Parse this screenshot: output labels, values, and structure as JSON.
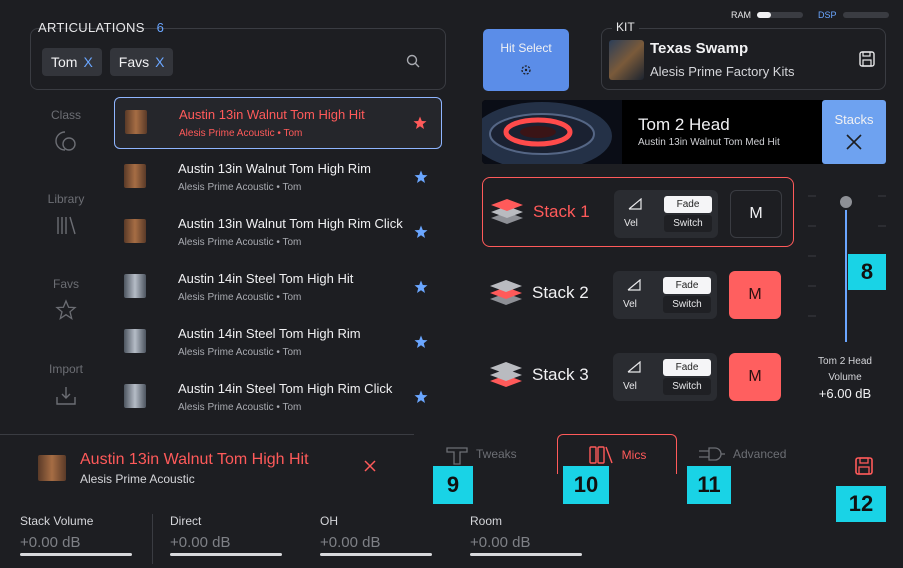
{
  "articulations": {
    "title": "ARTICULATIONS",
    "count": "6",
    "chips": [
      "Tom",
      "Favs"
    ]
  },
  "sidebar": {
    "items": [
      {
        "label": "Class",
        "icon": "class-icon"
      },
      {
        "label": "Library",
        "icon": "library-icon"
      },
      {
        "label": "Favs",
        "icon": "star-outline-icon"
      },
      {
        "label": "Import",
        "icon": "import-icon"
      }
    ]
  },
  "list": [
    {
      "name": "Austin 13in Walnut Tom High Hit",
      "sub": "Alesis Prime Acoustic • Tom",
      "selected": true,
      "star_color": "#ff5a5a"
    },
    {
      "name": "Austin 13in Walnut Tom High Rim",
      "sub": "Alesis Prime Acoustic • Tom",
      "selected": false
    },
    {
      "name": "Austin 13in Walnut Tom High Rim Click",
      "sub": "Alesis Prime Acoustic • Tom",
      "selected": false
    },
    {
      "name": "Austin 14in Steel Tom High Hit",
      "sub": "Alesis Prime Acoustic • Tom",
      "selected": false
    },
    {
      "name": "Austin 14in Steel Tom High Rim",
      "sub": "Alesis Prime Acoustic • Tom",
      "selected": false
    },
    {
      "name": "Austin 14in Steel Tom High Rim Click",
      "sub": "Alesis Prime Acoustic • Tom",
      "selected": false
    }
  ],
  "meters": {
    "ram": "RAM",
    "dsp": "DSP"
  },
  "hit_select": {
    "label": "Hit Select"
  },
  "kit": {
    "section": "KIT",
    "name": "Texas Swamp",
    "library": "Alesis Prime Factory Kits"
  },
  "drum": {
    "title": "Tom 2 Head",
    "sub": "Austin 13in Walnut Tom Med Hit",
    "stacks_label": "Stacks"
  },
  "stacks": [
    {
      "label": "Stack 1",
      "vel": "Vel",
      "fade": "Fade",
      "switch": "Switch",
      "m": "M",
      "active": true,
      "muted": false
    },
    {
      "label": "Stack 2",
      "vel": "Vel",
      "fade": "Fade",
      "switch": "Switch",
      "m": "M",
      "active": false,
      "muted": true
    },
    {
      "label": "Stack 3",
      "vel": "Vel",
      "fade": "Fade",
      "switch": "Switch",
      "m": "M",
      "active": false,
      "muted": true
    }
  ],
  "volume": {
    "label_line1": "Tom 2 Head",
    "label_line2": "Volume",
    "value": "+6.00 dB"
  },
  "selected_hit": {
    "name": "Austin 13in Walnut Tom High Hit",
    "library": "Alesis Prime Acoustic"
  },
  "tabs": [
    {
      "label": "Tweaks",
      "active": false
    },
    {
      "label": "Mics",
      "active": true
    },
    {
      "label": "Advanced",
      "active": false
    }
  ],
  "mixer": [
    {
      "label": "Stack Volume",
      "value": "+0.00 dB"
    },
    {
      "label": "Direct",
      "value": "+0.00 dB"
    },
    {
      "label": "OH",
      "value": "+0.00 dB"
    },
    {
      "label": "Room",
      "value": "+0.00 dB"
    }
  ],
  "callouts": [
    "8",
    "9",
    "10",
    "11",
    "12"
  ],
  "colors": {
    "accent_red": "#ff5a5a",
    "accent_blue": "#6aa6ff",
    "callout": "#19d3e6",
    "mute_red": "#ff5f5f"
  }
}
